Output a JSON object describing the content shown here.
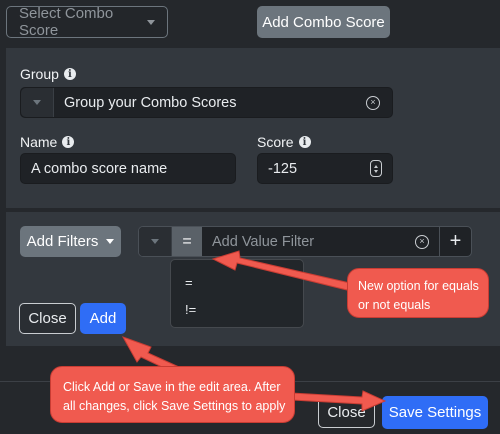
{
  "top": {
    "select_label": "Select Combo Score",
    "add_label": "Add Combo Score"
  },
  "group": {
    "label": "Group",
    "value": "Group your Combo Scores"
  },
  "name": {
    "label": "Name",
    "value": "A combo score name"
  },
  "score": {
    "label": "Score",
    "value": "-125"
  },
  "filters": {
    "add_filters_label": "Add Filters",
    "operator_symbol": "=",
    "value_placeholder": "Add Value Filter",
    "plus_symbol": "+",
    "operator_options": [
      "=",
      "!="
    ]
  },
  "actions": {
    "close_label": "Close",
    "add_label": "Add"
  },
  "footer": {
    "close_label": "Close",
    "save_label": "Save Settings"
  },
  "annotations": {
    "equals_note": "New option for equals or not equals",
    "save_note": "Click Add or Save in the edit area. After all changes, click Save Settings to apply"
  },
  "colors": {
    "primary": "#2f6df6",
    "callout": "#f05a4f",
    "panel": "#33383e",
    "background": "#25282c"
  }
}
